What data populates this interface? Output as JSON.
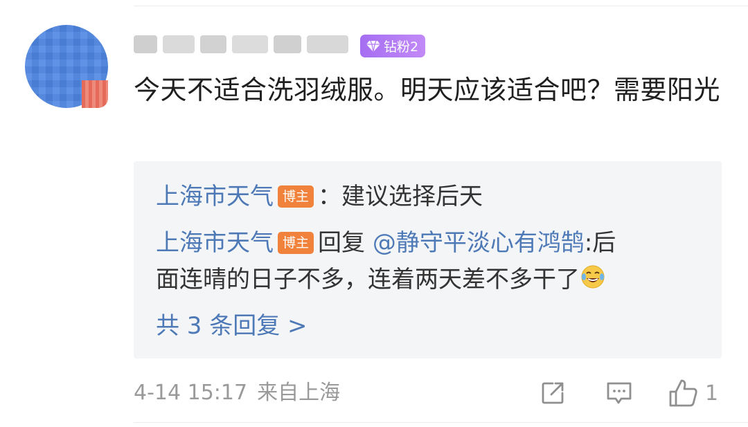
{
  "comment": {
    "fan_badge_label": "钻粉2",
    "text": "今天不适合洗羽绒服。明天应该适合吧？需要阳光",
    "time": "4-14 15:17",
    "location": "来自上海",
    "like_count": "1"
  },
  "replies": [
    {
      "author": "上海市天气",
      "tag": "博主",
      "text": "：建议选择后天"
    },
    {
      "author": "上海市天气",
      "tag": "博主",
      "reply_word": "回复",
      "mention": "@静守平淡心有鸿鹄",
      "text_line1": ":后",
      "text_line2": "面连晴的日子不多，连着两天差不多干了"
    }
  ],
  "more_replies_label": "共 3 条回复 >",
  "icons": {
    "diamond": "diamond-icon",
    "laugh": "laugh-cry-emoji-icon",
    "share": "share-icon",
    "comment": "comment-icon",
    "like": "thumbs-up-icon"
  },
  "colors": {
    "link": "#4d79b7",
    "blogger_tag": "#f1823b",
    "fan_badge": "#a56ef2",
    "reply_bg": "#f4f5f7"
  }
}
